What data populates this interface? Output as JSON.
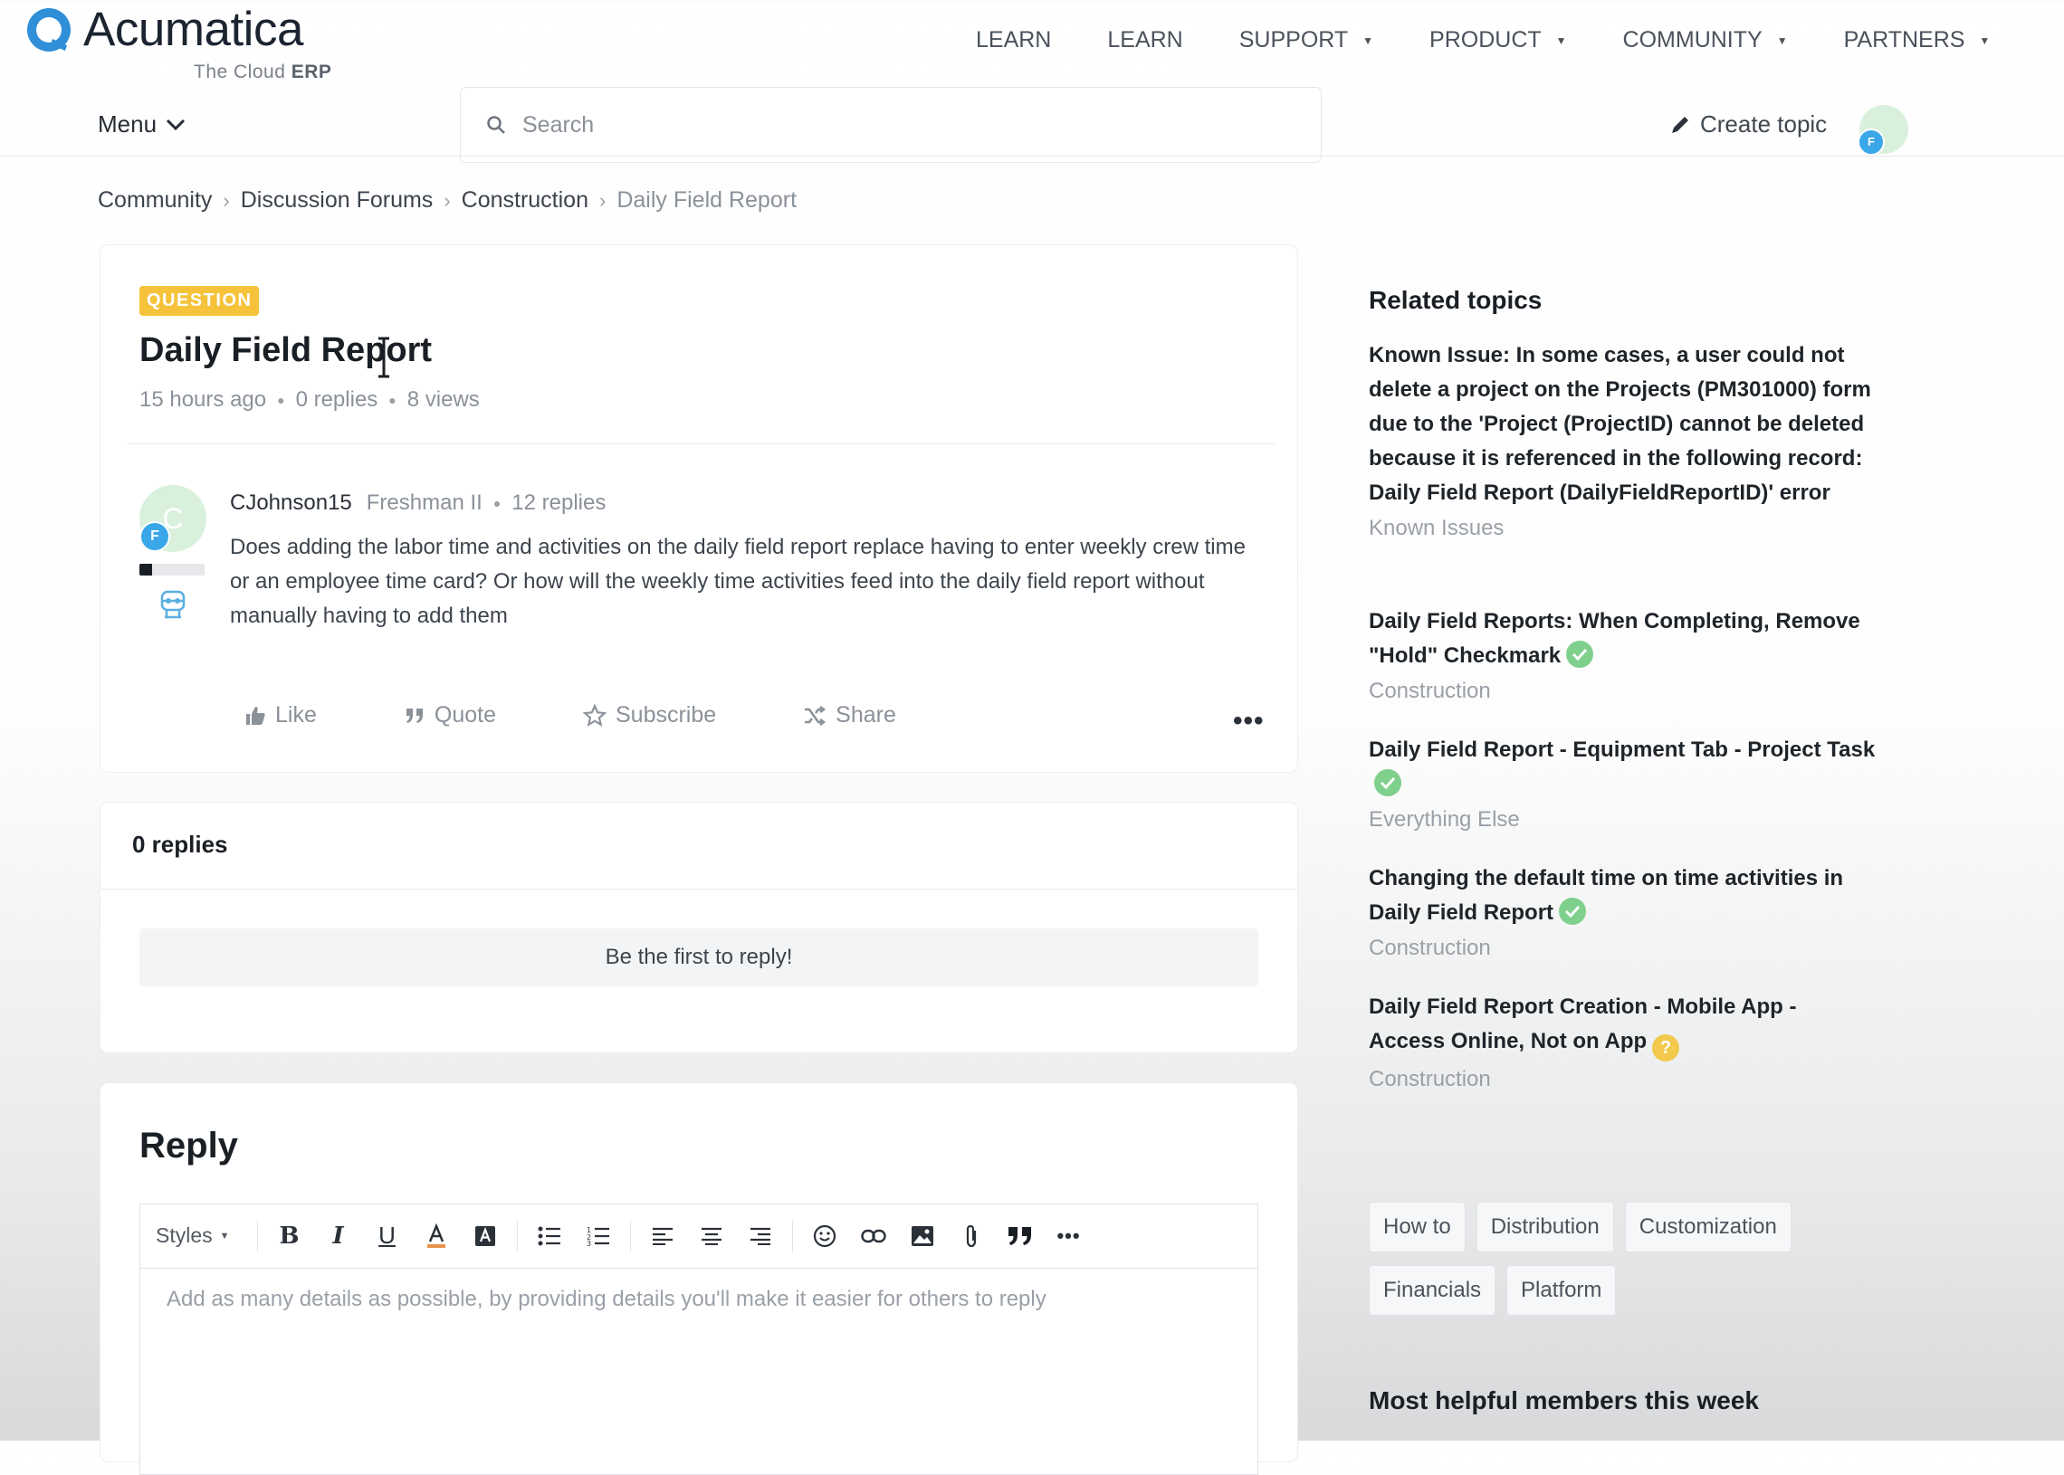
{
  "brand": {
    "name": "Acumatica",
    "tagline_prefix": "The Cloud",
    "tagline_bold": "ERP"
  },
  "topnav": [
    {
      "label": "LEARN",
      "caret": false
    },
    {
      "label": "LEARN",
      "caret": false
    },
    {
      "label": "SUPPORT",
      "caret": true
    },
    {
      "label": "PRODUCT",
      "caret": true
    },
    {
      "label": "COMMUNITY",
      "caret": true
    },
    {
      "label": "PARTNERS",
      "caret": true
    }
  ],
  "header": {
    "menu_label": "Menu",
    "search_placeholder": "Search",
    "create_topic_label": "Create topic",
    "user_badge": "F"
  },
  "breadcrumb": [
    "Community",
    "Discussion Forums",
    "Construction",
    "Daily Field Report"
  ],
  "post": {
    "type_badge": "QUESTION",
    "title": "Daily Field Report",
    "time": "15 hours ago",
    "replies": "0 replies",
    "views": "8 views",
    "author": {
      "initial": "C",
      "badge": "F",
      "name": "CJohnson15",
      "rank": "Freshman II",
      "replies": "12 replies",
      "rank_progress": 0.2
    },
    "body": "Does adding the labor time and activities on the daily field report replace having to enter weekly crew time or an employee time card? Or how will the weekly time activities feed into the daily field report without manually having to add them",
    "actions": {
      "like": "Like",
      "quote": "Quote",
      "subscribe": "Subscribe",
      "share": "Share"
    }
  },
  "replies_section": {
    "title": "0 replies",
    "empty_text": "Be the first to reply!"
  },
  "reply_editor": {
    "title": "Reply",
    "styles_label": "Styles",
    "placeholder": "Add as many details as possible, by providing details you'll make it easier for others to reply"
  },
  "sidebar": {
    "related_title": "Related topics",
    "topics": [
      {
        "title": "Known Issue: In some cases, a user could not delete a project on the Projects (PM301000) form due to the 'Project (ProjectID) cannot be deleted because it is referenced in the following record: Daily Field Report (DailyFieldReportID)' error",
        "category": "Known Issues",
        "status": "none"
      },
      {
        "title": "Daily Field Reports: When Completing, Remove \"Hold\" Checkmark",
        "category": "Construction",
        "status": "solved"
      },
      {
        "title": "Daily Field Report - Equipment Tab - Project Task",
        "category": "Everything Else",
        "status": "solved"
      },
      {
        "title": "Changing the default time on time activities in Daily Field Report",
        "category": "Construction",
        "status": "solved"
      },
      {
        "title": "Daily Field Report Creation - Mobile App - Access Online, Not on App",
        "category": "Construction",
        "status": "question"
      }
    ],
    "tags": [
      "How to",
      "Distribution",
      "Customization",
      "Financials",
      "Platform"
    ],
    "helpful_title": "Most helpful members this week"
  },
  "colors": {
    "accent_badge": "#f5c23a",
    "solved": "#7fd08c",
    "question": "#f2c94c",
    "user_badge": "#3aa7e8"
  }
}
